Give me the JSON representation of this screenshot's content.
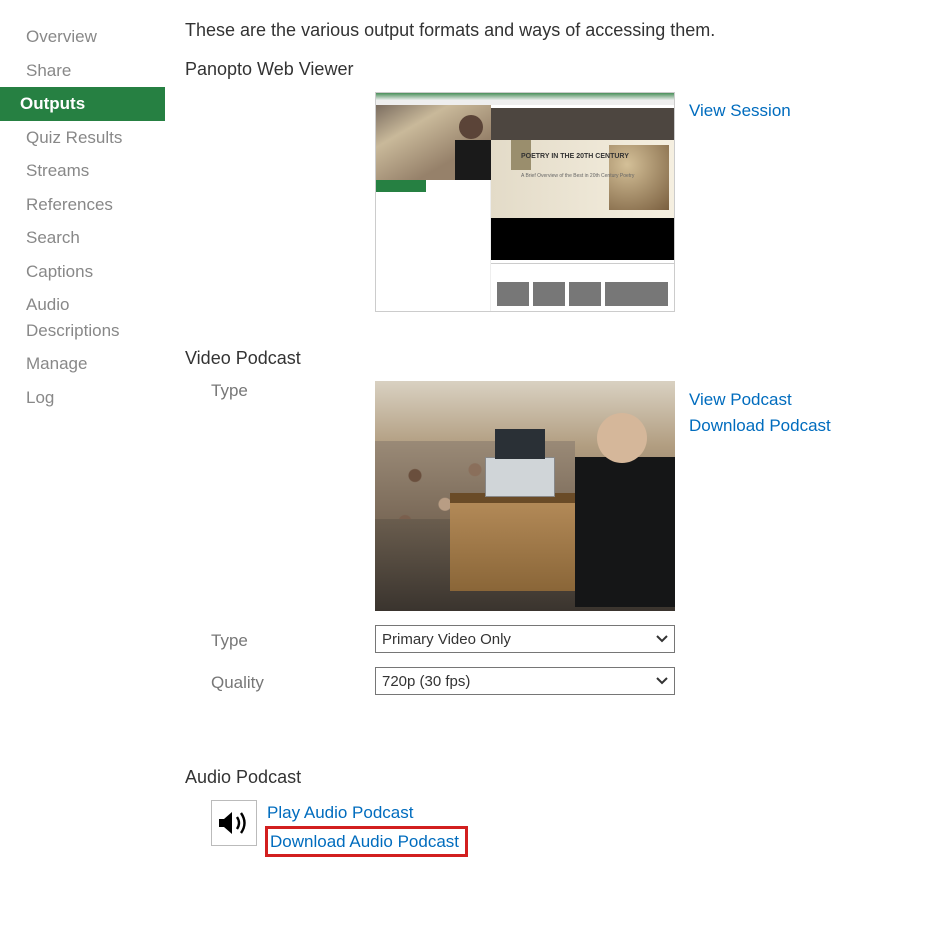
{
  "sidebar": {
    "items": [
      {
        "label": "Overview",
        "active": false
      },
      {
        "label": "Share",
        "active": false
      },
      {
        "label": "Outputs",
        "active": true
      },
      {
        "label": "Quiz Results",
        "active": false
      },
      {
        "label": "Streams",
        "active": false
      },
      {
        "label": "References",
        "active": false
      },
      {
        "label": "Search",
        "active": false
      },
      {
        "label": "Captions",
        "active": false
      },
      {
        "label": "Audio Descriptions",
        "active": false
      },
      {
        "label": "Manage",
        "active": false
      },
      {
        "label": "Log",
        "active": false
      }
    ]
  },
  "main": {
    "intro": "These are the various output formats and ways of accessing them.",
    "webviewer": {
      "title": "Panopto Web Viewer",
      "slideTitle": "POETRY IN THE 20TH CENTURY",
      "slideSubtitle": "A Brief Overview of the Best in 20th Century Poetry",
      "links": {
        "view": "View Session"
      }
    },
    "videopodcast": {
      "title": "Video Podcast",
      "typeLabel": "Type",
      "qualityLabel": "Quality",
      "typeSelectLabel": "Type",
      "typeValue": "Primary Video Only",
      "qualityValue": "720p (30 fps)",
      "links": {
        "view": "View Podcast",
        "download": "Download Podcast"
      }
    },
    "audiopodcast": {
      "title": "Audio Podcast",
      "links": {
        "play": "Play Audio Podcast",
        "download": "Download Audio Podcast"
      }
    }
  }
}
